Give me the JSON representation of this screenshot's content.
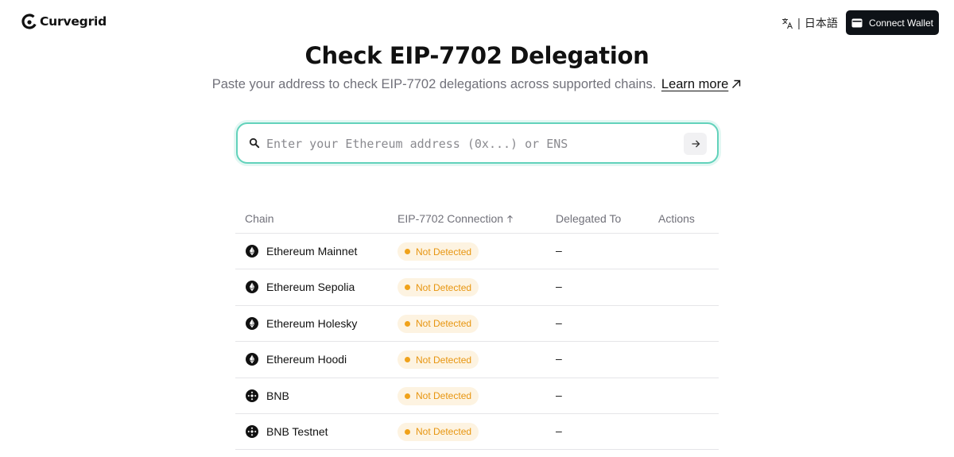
{
  "header": {
    "logo_text": "Curvegrid",
    "language_label": "日本語",
    "connect_label": "Connect Wallet"
  },
  "hero": {
    "title": "Check EIP-7702 Delegation",
    "subtitle": "Paste your address to check EIP-7702 delegations across supported chains.",
    "learn_more": "Learn more"
  },
  "search": {
    "placeholder": "Enter your Ethereum address (0x...) or ENS",
    "value": ""
  },
  "table": {
    "columns": [
      "Chain",
      "EIP-7702 Connection",
      "Delegated To",
      "Actions"
    ],
    "rows": [
      {
        "chain": "Ethereum Mainnet",
        "icon": "ethereum-icon",
        "status": "Not Detected",
        "delegated_to": "–"
      },
      {
        "chain": "Ethereum Sepolia",
        "icon": "ethereum-icon",
        "status": "Not Detected",
        "delegated_to": "–"
      },
      {
        "chain": "Ethereum Holesky",
        "icon": "ethereum-icon",
        "status": "Not Detected",
        "delegated_to": "–"
      },
      {
        "chain": "Ethereum Hoodi",
        "icon": "ethereum-icon",
        "status": "Not Detected",
        "delegated_to": "–"
      },
      {
        "chain": "BNB",
        "icon": "bnb-icon",
        "status": "Not Detected",
        "delegated_to": "–"
      },
      {
        "chain": "BNB Testnet",
        "icon": "bnb-icon",
        "status": "Not Detected",
        "delegated_to": "–"
      }
    ]
  },
  "colors": {
    "accent": "#62d2bb",
    "badge_bg": "#fdf3e1",
    "badge_text": "#e7950f",
    "button_bg": "#0e1217"
  }
}
